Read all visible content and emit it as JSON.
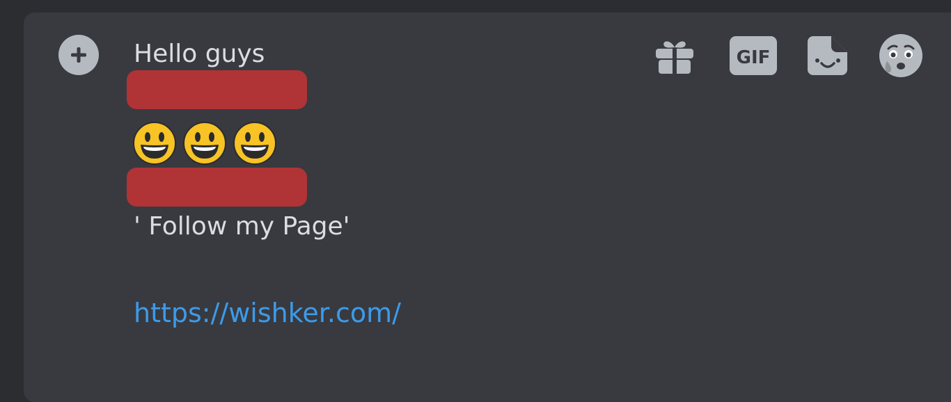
{
  "composer": {
    "lines": [
      "Hello guys",
      "' Follow my Page'"
    ],
    "emojis": [
      "smiley-emoji",
      "smiley-emoji",
      "smiley-emoji"
    ],
    "link": "https://wishker.com/"
  },
  "toolbar": {
    "gif_label": "GIF",
    "icons": [
      "plus-icon",
      "gift-icon",
      "gif-icon",
      "sticker-icon",
      "emoji-picker-icon"
    ]
  },
  "colors": {
    "background": "#2b2d31",
    "composer": "#383a40",
    "text": "#dbdee1",
    "icon": "#b5bac1",
    "link": "#3d9be9",
    "redaction": "#b03336"
  }
}
